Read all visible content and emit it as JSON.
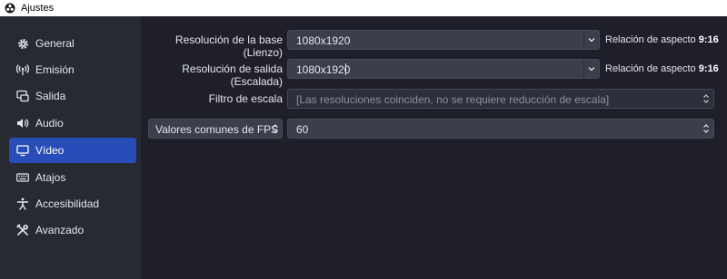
{
  "window": {
    "title": "Ajustes",
    "app_icon": "obs-logo-icon"
  },
  "sidebar": {
    "items": [
      {
        "label": "General",
        "icon": "gear-icon",
        "active": false
      },
      {
        "label": "Emisión",
        "icon": "broadcast-icon",
        "active": false
      },
      {
        "label": "Salida",
        "icon": "output-icon",
        "active": false
      },
      {
        "label": "Audio",
        "icon": "speaker-icon",
        "active": false
      },
      {
        "label": "Vídeo",
        "icon": "monitor-icon",
        "active": true
      },
      {
        "label": "Atajos",
        "icon": "keyboard-icon",
        "active": false
      },
      {
        "label": "Accesibilidad",
        "icon": "accessibility-icon",
        "active": false
      },
      {
        "label": "Avanzado",
        "icon": "tools-icon",
        "active": false
      }
    ]
  },
  "video": {
    "base_resolution": {
      "label": "Resolución de la base (Lienzo)",
      "value": "1080x1920",
      "aspect_prefix": "Relación de aspecto",
      "aspect_value": "9:16"
    },
    "output_resolution": {
      "label": "Resolución de salida (Escalada)",
      "value": "1080x1920",
      "aspect_prefix": "Relación de aspecto",
      "aspect_value": "9:16"
    },
    "scale_filter": {
      "label": "Filtro de escala",
      "value": "[Las resoluciones coinciden, no se requiere reducción de escala]"
    },
    "fps": {
      "type_label": "Valores comunes de FPS",
      "value": "60"
    }
  },
  "colors": {
    "accent": "#284cb8",
    "background": "#1e1f29",
    "sidebar": "#272a33",
    "field": "#3b3e4b"
  }
}
